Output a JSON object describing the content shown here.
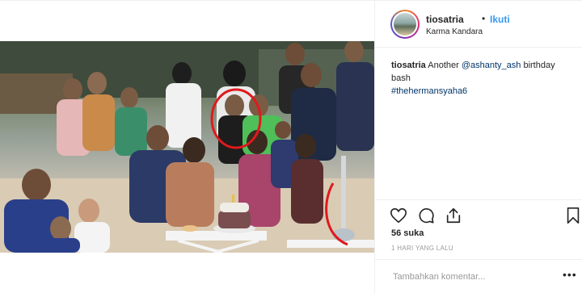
{
  "post": {
    "author": "tiosatria",
    "separator": "•",
    "follow_label": "Ikuti",
    "location": "Karma Kandara",
    "caption": {
      "username": "tiosatria",
      "text_before": "Another",
      "mention": "@ashanty_ash",
      "text_after": "birthday bash",
      "hashtag": "#thehermansyaha6"
    },
    "likes": "56 suka",
    "timestamp": "1 HARI YANG LALU",
    "comment_placeholder": "Tambahkan komentar...",
    "more_label": "•••"
  },
  "icons": {
    "like": "heart-icon",
    "comment": "comment-icon",
    "share": "share-icon",
    "save": "bookmark-icon"
  },
  "colors": {
    "link": "#3897f0",
    "hashtag": "#003569",
    "highlight_circle": "#e0191d"
  }
}
